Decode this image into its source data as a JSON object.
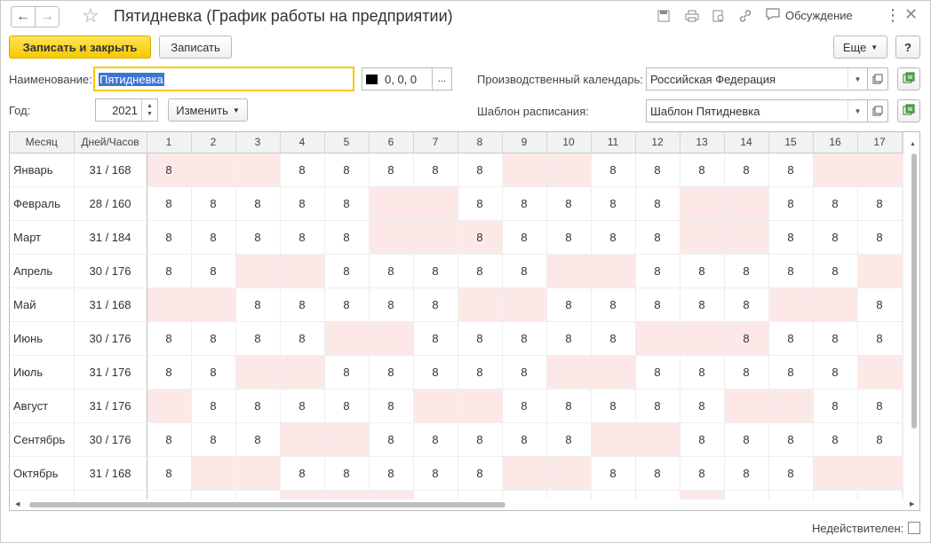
{
  "window": {
    "title": "Пятидневка (График работы на предприятии)",
    "discuss_label": "Обсуждение"
  },
  "toolbar": {
    "save_close_label": "Записать и закрыть",
    "save_label": "Записать",
    "more_label": "Еще",
    "help_label": "?"
  },
  "form": {
    "name_label": "Наименование:",
    "name_value": "Пятидневка",
    "color_value": "0, 0, 0",
    "color_ellipsis": "...",
    "year_label": "Год:",
    "year_value": "2021",
    "change_label": "Изменить",
    "calendar_label": "Производственный календарь:",
    "calendar_value": "Российская Федерация",
    "template_label": "Шаблон расписания:",
    "template_value": "Шаблон Пятидневка"
  },
  "table": {
    "col_month": "Месяц",
    "col_days_hours": "Дней/Часов",
    "day_headers": [
      "1",
      "2",
      "3",
      "4",
      "5",
      "6",
      "7",
      "8",
      "9",
      "10",
      "11",
      "12",
      "13",
      "14",
      "15",
      "16",
      "17"
    ],
    "rows": [
      {
        "month": "Январь",
        "dh": "31 / 168",
        "days": [
          "8",
          "",
          "",
          "8",
          "8",
          "8",
          "8",
          "8",
          "",
          "",
          "8",
          "8",
          "8",
          "8",
          "8",
          "",
          ""
        ],
        "off": [
          1,
          1,
          1,
          0,
          0,
          0,
          0,
          0,
          1,
          1,
          0,
          0,
          0,
          0,
          0,
          1,
          1
        ]
      },
      {
        "month": "Февраль",
        "dh": "28 / 160",
        "days": [
          "8",
          "8",
          "8",
          "8",
          "8",
          "",
          "",
          "8",
          "8",
          "8",
          "8",
          "8",
          "",
          "",
          "8",
          "8",
          "8"
        ],
        "off": [
          0,
          0,
          0,
          0,
          0,
          1,
          1,
          0,
          0,
          0,
          0,
          0,
          1,
          1,
          0,
          0,
          0
        ]
      },
      {
        "month": "Март",
        "dh": "31 / 184",
        "days": [
          "8",
          "8",
          "8",
          "8",
          "8",
          "",
          "",
          "8",
          "8",
          "8",
          "8",
          "8",
          "",
          "",
          "8",
          "8",
          "8"
        ],
        "off": [
          0,
          0,
          0,
          0,
          0,
          1,
          1,
          1,
          0,
          0,
          0,
          0,
          1,
          1,
          0,
          0,
          0
        ]
      },
      {
        "month": "Апрель",
        "dh": "30 / 176",
        "days": [
          "8",
          "8",
          "",
          "",
          "8",
          "8",
          "8",
          "8",
          "8",
          "",
          "",
          "8",
          "8",
          "8",
          "8",
          "8",
          ""
        ],
        "off": [
          0,
          0,
          1,
          1,
          0,
          0,
          0,
          0,
          0,
          1,
          1,
          0,
          0,
          0,
          0,
          0,
          1
        ]
      },
      {
        "month": "Май",
        "dh": "31 / 168",
        "days": [
          "",
          "",
          "8",
          "8",
          "8",
          "8",
          "8",
          "",
          "",
          "8",
          "8",
          "8",
          "8",
          "8",
          "",
          "",
          "8"
        ],
        "off": [
          1,
          1,
          0,
          0,
          0,
          0,
          0,
          1,
          1,
          0,
          0,
          0,
          0,
          0,
          1,
          1,
          0
        ]
      },
      {
        "month": "Июнь",
        "dh": "30 / 176",
        "days": [
          "8",
          "8",
          "8",
          "8",
          "",
          "",
          "8",
          "8",
          "8",
          "8",
          "8",
          "",
          "",
          "8",
          "8",
          "8",
          "8"
        ],
        "off": [
          0,
          0,
          0,
          0,
          1,
          1,
          0,
          0,
          0,
          0,
          0,
          1,
          1,
          1,
          0,
          0,
          0
        ]
      },
      {
        "month": "Июль",
        "dh": "31 / 176",
        "days": [
          "8",
          "8",
          "",
          "",
          "8",
          "8",
          "8",
          "8",
          "8",
          "",
          "",
          "8",
          "8",
          "8",
          "8",
          "8",
          ""
        ],
        "off": [
          0,
          0,
          1,
          1,
          0,
          0,
          0,
          0,
          0,
          1,
          1,
          0,
          0,
          0,
          0,
          0,
          1
        ]
      },
      {
        "month": "Август",
        "dh": "31 / 176",
        "days": [
          "",
          "8",
          "8",
          "8",
          "8",
          "8",
          "",
          "",
          "8",
          "8",
          "8",
          "8",
          "8",
          "",
          "",
          "8",
          "8"
        ],
        "off": [
          1,
          0,
          0,
          0,
          0,
          0,
          1,
          1,
          0,
          0,
          0,
          0,
          0,
          1,
          1,
          0,
          0
        ]
      },
      {
        "month": "Сентябрь",
        "dh": "30 / 176",
        "days": [
          "8",
          "8",
          "8",
          "",
          "",
          "8",
          "8",
          "8",
          "8",
          "8",
          "",
          "",
          "8",
          "8",
          "8",
          "8",
          "8"
        ],
        "off": [
          0,
          0,
          0,
          1,
          1,
          0,
          0,
          0,
          0,
          0,
          1,
          1,
          0,
          0,
          0,
          0,
          0
        ]
      },
      {
        "month": "Октябрь",
        "dh": "31 / 168",
        "days": [
          "8",
          "",
          "",
          "8",
          "8",
          "8",
          "8",
          "8",
          "",
          "",
          "8",
          "8",
          "8",
          "8",
          "8",
          "",
          ""
        ],
        "off": [
          0,
          1,
          1,
          0,
          0,
          0,
          0,
          0,
          1,
          1,
          0,
          0,
          0,
          0,
          0,
          1,
          1
        ]
      },
      {
        "month": "",
        "dh": "",
        "days": [
          "",
          "",
          "",
          "",
          "",
          "",
          "",
          "",
          "",
          "",
          "",
          "",
          "",
          "",
          "",
          "",
          ""
        ],
        "off": [
          0,
          0,
          0,
          1,
          1,
          1,
          0,
          0,
          0,
          0,
          0,
          0,
          1,
          0,
          0,
          0,
          0
        ]
      }
    ]
  },
  "footer": {
    "inactive_label": "Недействителен:"
  },
  "colors": {
    "accent_yellow": "#f5c900",
    "selection_blue": "#3b76d3",
    "weekend_pink": "#fde8e8"
  }
}
